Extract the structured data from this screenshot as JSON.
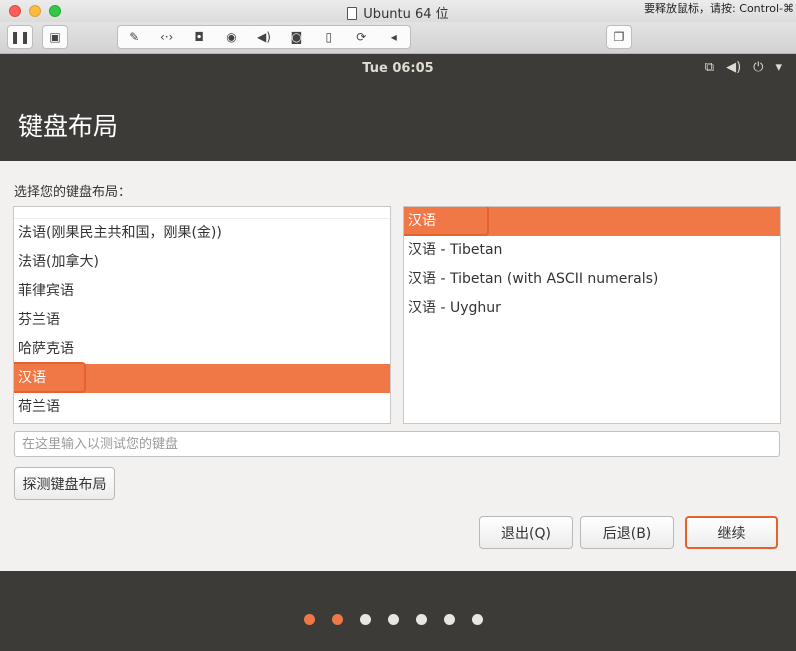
{
  "window": {
    "title": "Ubuntu 64 位",
    "release_hint": "要释放鼠标，请按: Control-⌘"
  },
  "toolbar": {
    "pause_icon": "pause-icon",
    "snapshot_icon": "snapshot-icon",
    "device_icons": [
      "wrench-icon",
      "network-arrows-icon",
      "harddisk-icon",
      "disc-icon",
      "volume-icon",
      "camera-icon",
      "usb-icon",
      "sharing-icon",
      "collapse-arrow-icon"
    ],
    "fullscreen_icon": "window-icon"
  },
  "topbar": {
    "clock": "Tue 06:05",
    "indicators": [
      "network-icon",
      "volume-icon",
      "power-icon",
      "chevron-down-icon"
    ]
  },
  "header": {
    "title": "键盘布局"
  },
  "main": {
    "prompt": "选择您的键盘布局：",
    "layouts": [
      "法语(刚果民主共和国，刚果(金))",
      "法语(加拿大)",
      "菲律宾语",
      "芬兰语",
      "哈萨克语",
      "汉语",
      "荷兰语"
    ],
    "selected_layout_index": 5,
    "variants": [
      "汉语",
      "汉语 - Tibetan",
      "汉语 - Tibetan (with ASCII numerals)",
      "汉语 - Uyghur"
    ],
    "selected_variant_index": 0,
    "test_placeholder": "在这里输入以测试您的键盘",
    "detect_label": "探测键盘布局"
  },
  "buttons": {
    "quit": "退出(Q)",
    "back": "后退(B)",
    "continue": "继续"
  },
  "progress": {
    "total_steps": 7,
    "completed_steps": 2
  },
  "colors": {
    "accent": "#f07746",
    "highlight_border": "#e5622d",
    "ubuntu_dark": "#3c3b37"
  }
}
